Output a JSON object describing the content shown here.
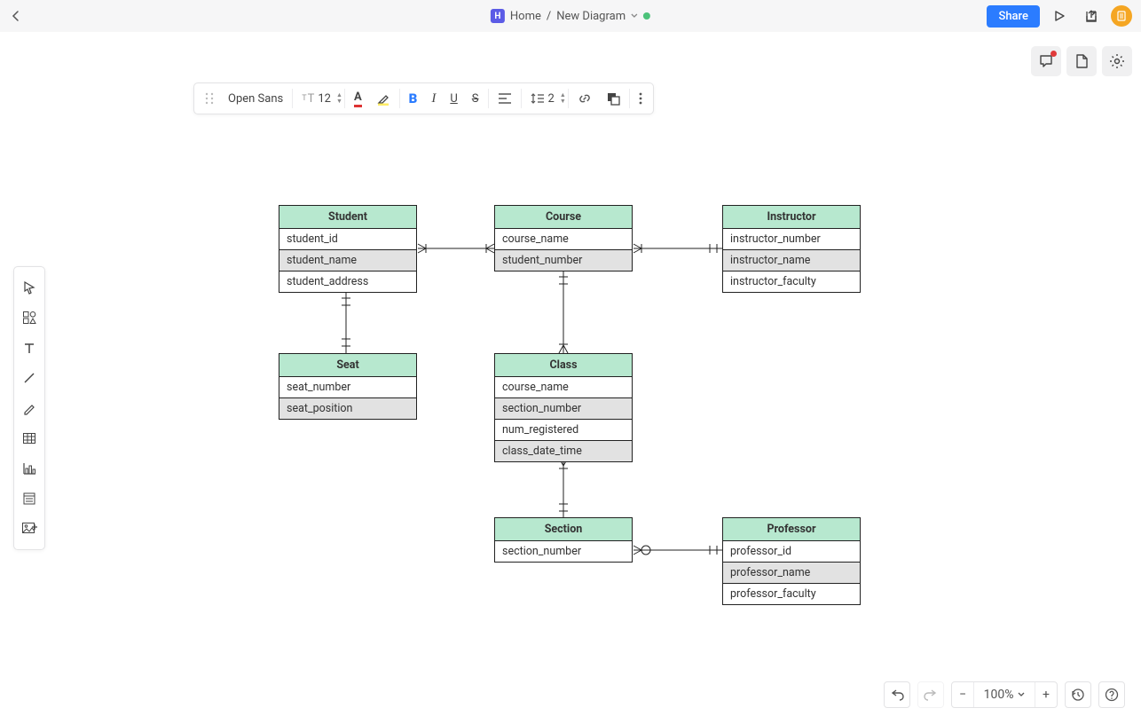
{
  "header": {
    "home_label": "Home",
    "diagram_name": "New Diagram",
    "share_label": "Share",
    "badge_letter": "H"
  },
  "format": {
    "font_family": "Open Sans",
    "font_size": "12",
    "line_weight": "2"
  },
  "zoom": {
    "level": "100%"
  },
  "entities": {
    "student": {
      "title": "Student",
      "rows": [
        "student_id",
        "student_name",
        "student_address"
      ]
    },
    "course": {
      "title": "Course",
      "rows": [
        "course_name",
        "student_number"
      ]
    },
    "instructor": {
      "title": "Instructor",
      "rows": [
        "instructor_number",
        "instructor_name",
        "instructor_faculty"
      ]
    },
    "seat": {
      "title": "Seat",
      "rows": [
        "seat_number",
        "seat_position"
      ]
    },
    "cls": {
      "title": "Class",
      "rows": [
        "course_name",
        "section_number",
        "num_registered",
        "class_date_time"
      ]
    },
    "section": {
      "title": "Section",
      "rows": [
        "section_number"
      ]
    },
    "professor": {
      "title": "Professor",
      "rows": [
        "professor_id",
        "professor_name",
        "professor_faculty"
      ]
    }
  }
}
